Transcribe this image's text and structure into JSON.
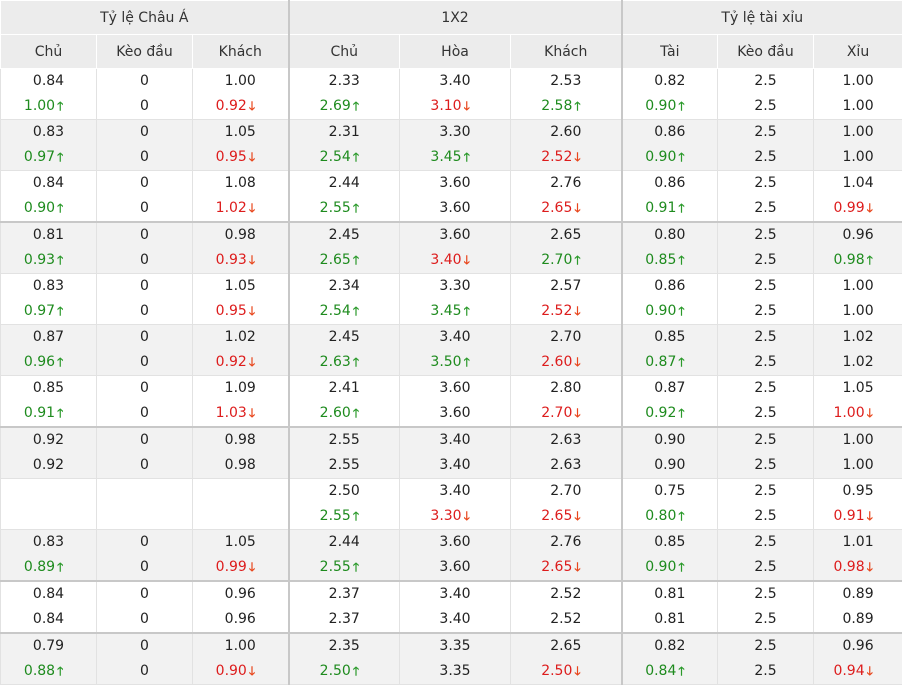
{
  "headers": {
    "groups": [
      "Tỷ lệ Châu Á",
      "1X2",
      "Tỷ lệ tài xỉu"
    ],
    "columns": [
      "Chủ",
      "Kèo đầu",
      "Khách",
      "Chủ",
      "Hòa",
      "Khách",
      "Tài",
      "Kèo đầu",
      "Xỉu"
    ]
  },
  "arrow_glyphs": {
    "up": "🡑",
    "down": "🡓"
  },
  "colors": {
    "up": "#1e8b1e",
    "down": "#dd1c1c",
    "header_bg": "#ececec",
    "alt_row_bg": "#f2f2f2"
  },
  "rows": [
    {
      "top": [
        "0.84",
        "0",
        "1.00",
        "2.33",
        "3.40",
        "2.53",
        "0.82",
        "2.5",
        "1.00"
      ],
      "bottom": [
        "1.00",
        "0",
        "0.92",
        "2.69",
        "3.10",
        "2.58",
        "0.90",
        "2.5",
        "1.00"
      ],
      "trend": [
        "up",
        "",
        "down",
        "up",
        "down",
        "up",
        "up",
        "",
        ""
      ]
    },
    {
      "top": [
        "0.83",
        "0",
        "1.05",
        "2.31",
        "3.30",
        "2.60",
        "0.86",
        "2.5",
        "1.00"
      ],
      "bottom": [
        "0.97",
        "0",
        "0.95",
        "2.54",
        "3.45",
        "2.52",
        "0.90",
        "2.5",
        "1.00"
      ],
      "trend": [
        "up",
        "",
        "down",
        "up",
        "up",
        "down",
        "up",
        "",
        ""
      ]
    },
    {
      "top": [
        "0.84",
        "0",
        "1.08",
        "2.44",
        "3.60",
        "2.76",
        "0.86",
        "2.5",
        "1.04"
      ],
      "bottom": [
        "0.90",
        "0",
        "1.02",
        "2.55",
        "3.60",
        "2.65",
        "0.91",
        "2.5",
        "0.99"
      ],
      "trend": [
        "up",
        "",
        "down",
        "up",
        "",
        "down",
        "up",
        "",
        "down"
      ]
    },
    {
      "top": [
        "0.81",
        "0",
        "0.98",
        "2.45",
        "3.60",
        "2.65",
        "0.80",
        "2.5",
        "0.96"
      ],
      "bottom": [
        "0.93",
        "0",
        "0.93",
        "2.65",
        "3.40",
        "2.70",
        "0.85",
        "2.5",
        "0.98"
      ],
      "trend": [
        "up",
        "",
        "down",
        "up",
        "down",
        "up",
        "up",
        "",
        "up"
      ]
    },
    {
      "top": [
        "0.83",
        "0",
        "1.05",
        "2.34",
        "3.30",
        "2.57",
        "0.86",
        "2.5",
        "1.00"
      ],
      "bottom": [
        "0.97",
        "0",
        "0.95",
        "2.54",
        "3.45",
        "2.52",
        "0.90",
        "2.5",
        "1.00"
      ],
      "trend": [
        "up",
        "",
        "down",
        "up",
        "up",
        "down",
        "up",
        "",
        ""
      ]
    },
    {
      "top": [
        "0.87",
        "0",
        "1.02",
        "2.45",
        "3.40",
        "2.70",
        "0.85",
        "2.5",
        "1.02"
      ],
      "bottom": [
        "0.96",
        "0",
        "0.92",
        "2.63",
        "3.50",
        "2.60",
        "0.87",
        "2.5",
        "1.02"
      ],
      "trend": [
        "up",
        "",
        "down",
        "up",
        "up",
        "down",
        "up",
        "",
        ""
      ]
    },
    {
      "top": [
        "0.85",
        "0",
        "1.09",
        "2.41",
        "3.60",
        "2.80",
        "0.87",
        "2.5",
        "1.05"
      ],
      "bottom": [
        "0.91",
        "0",
        "1.03",
        "2.60",
        "3.60",
        "2.70",
        "0.92",
        "2.5",
        "1.00"
      ],
      "trend": [
        "up",
        "",
        "down",
        "up",
        "",
        "down",
        "up",
        "",
        "down"
      ]
    },
    {
      "top": [
        "0.92",
        "0",
        "0.98",
        "2.55",
        "3.40",
        "2.63",
        "0.90",
        "2.5",
        "1.00"
      ],
      "bottom": [
        "0.92",
        "0",
        "0.98",
        "2.55",
        "3.40",
        "2.63",
        "0.90",
        "2.5",
        "1.00"
      ],
      "trend": [
        "",
        "",
        "",
        "",
        "",
        "",
        "",
        "",
        ""
      ]
    },
    {
      "top": [
        "",
        "",
        "",
        "2.50",
        "3.40",
        "2.70",
        "0.75",
        "2.5",
        "0.95"
      ],
      "bottom": [
        "",
        "",
        "",
        "2.55",
        "3.30",
        "2.65",
        "0.80",
        "2.5",
        "0.91"
      ],
      "trend": [
        "",
        "",
        "",
        "up",
        "down",
        "down",
        "up",
        "",
        "down"
      ]
    },
    {
      "top": [
        "0.83",
        "0",
        "1.05",
        "2.44",
        "3.60",
        "2.76",
        "0.85",
        "2.5",
        "1.01"
      ],
      "bottom": [
        "0.89",
        "0",
        "0.99",
        "2.55",
        "3.60",
        "2.65",
        "0.90",
        "2.5",
        "0.98"
      ],
      "trend": [
        "up",
        "",
        "down",
        "up",
        "",
        "down",
        "up",
        "",
        "down"
      ]
    },
    {
      "top": [
        "0.84",
        "0",
        "0.96",
        "2.37",
        "3.40",
        "2.52",
        "0.81",
        "2.5",
        "0.89"
      ],
      "bottom": [
        "0.84",
        "0",
        "0.96",
        "2.37",
        "3.40",
        "2.52",
        "0.81",
        "2.5",
        "0.89"
      ],
      "trend": [
        "",
        "",
        "",
        "",
        "",
        "",
        "",
        "",
        ""
      ]
    },
    {
      "top": [
        "0.79",
        "0",
        "1.00",
        "2.35",
        "3.35",
        "2.65",
        "0.82",
        "2.5",
        "0.96"
      ],
      "bottom": [
        "0.88",
        "0",
        "0.90",
        "2.50",
        "3.35",
        "2.50",
        "0.84",
        "2.5",
        "0.94"
      ],
      "trend": [
        "up",
        "",
        "down",
        "up",
        "",
        "down",
        "up",
        "",
        "down"
      ]
    }
  ]
}
